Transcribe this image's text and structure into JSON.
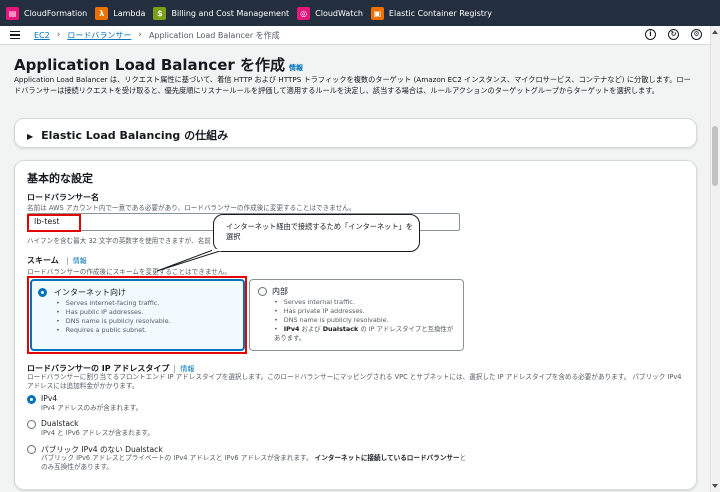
{
  "topbar": {
    "services": [
      {
        "label": "CloudFormation",
        "icon": "cloudformation-icon",
        "color": "#e7157b"
      },
      {
        "label": "Lambda",
        "icon": "lambda-icon",
        "color": "#ed7100"
      },
      {
        "label": "Billing and Cost Management",
        "icon": "billing-icon",
        "color": "#7aa116"
      },
      {
        "label": "CloudWatch",
        "icon": "cloudwatch-icon",
        "color": "#e7157b"
      },
      {
        "label": "Elastic Container Registry",
        "icon": "ecr-icon",
        "color": "#ed7100"
      }
    ]
  },
  "breadcrumb": {
    "items": [
      {
        "label": "EC2",
        "link": true
      },
      {
        "label": "ロードバランサー",
        "link": true
      },
      {
        "label": "Application Load Balancer を作成",
        "link": false
      }
    ]
  },
  "page": {
    "title": "Application Load Balancer を作成",
    "info": "情報",
    "description": "Application Load Balancer は、リクエスト属性に基づいて、着信 HTTP および HTTPS トラフィックを複数のターゲット (Amazon EC2 インスタンス、マイクロサービス、コンテナなど) に分散します。ロードバランサーは接続リクエストを受け取ると、優先度順にリスナールールを評価して適用するルールを決定し、該当する場合は、ルールアクションのターゲットグループからターゲットを選択します。"
  },
  "elb_how": {
    "title": "Elastic Load Balancing の仕組み"
  },
  "basic": {
    "title": "基本的な設定",
    "name_label": "ロードバランサー名",
    "name_desc": "名前は AWS アカウント内で一意である必要があり、ロードバランサーの作成後に変更することはできません。",
    "name_value": "lb-test",
    "name_hint": "ハイフンを含む最大 32 文字の英数字を使用できますが、名前",
    "callout": "インターネット経由で接続するため「インターネット」を選択",
    "scheme_label": "スキーム",
    "scheme_info": "情報",
    "scheme_desc": "ロードバランサーの作成後にスキームを変更することはできません。",
    "scheme_internet": {
      "title": "インターネット向け",
      "selected": true,
      "bullets": [
        "Serves internet-facing traffic.",
        "Has public IP addresses.",
        "DNS name is publicly resolvable.",
        "Requires a public subnet."
      ]
    },
    "scheme_internal": {
      "title": "内部",
      "selected": false,
      "bullets": [
        "Serves internal traffic.",
        "Has private IP addresses.",
        "DNS name is publicly resolvable."
      ],
      "last_bullet_bold1": "IPv4",
      "last_bullet_mid": " および ",
      "last_bullet_bold2": "Dualstack",
      "last_bullet_rest": " の IP アドレスタイプと互換性があります。"
    },
    "ip_label": "ロードバランサーの IP アドレスタイプ",
    "ip_info": "情報",
    "ip_desc": "ロードバランサーに割り当てるフロントエンド IP アドレスタイプを選択します。このロードバランサーにマッピングされる VPC とサブネットには、選択した IP アドレスタイプを含める必要があります。 パブリック IPv4 アドレスには追加料金がかかります。",
    "ip_options": [
      {
        "title": "IPv4",
        "desc": "IPv4 アドレスのみが含まれます。",
        "selected": true
      },
      {
        "title": "Dualstack",
        "desc": "IPv4 と IPv6 アドレスが含まれます。",
        "selected": false
      },
      {
        "title": "パブリック IPv4 のない Dualstack",
        "desc_a": "パブリック IPv6 アドレスとプライベートの IPv4 アドレスと IPv6 アドレスが含まれます。",
        "desc_bold": "インターネットに接続しているロードバランサー",
        "desc_b": "とのみ互換性があります。",
        "selected": false
      }
    ]
  },
  "colors": {
    "accent": "#0073bb",
    "highlight": "#e10600",
    "topbar": "#232f3e"
  }
}
